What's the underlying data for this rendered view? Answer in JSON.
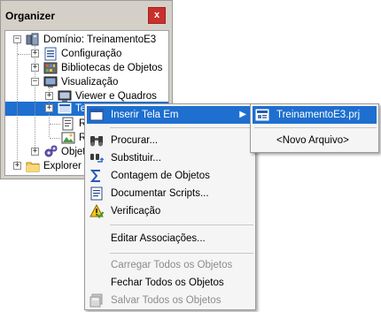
{
  "organizer": {
    "title": "Organizer",
    "close_glyph": "x",
    "tree": [
      {
        "label": "Domínio: TreinamentoE3",
        "icon": "domain-icon"
      },
      {
        "label": "Configuração",
        "icon": "config-icon"
      },
      {
        "label": "Bibliotecas de Objetos",
        "icon": "library-icon"
      },
      {
        "label": "Visualização",
        "icon": "visualization-icon"
      },
      {
        "label": "Viewer e Quadros",
        "icon": "viewer-icon"
      },
      {
        "label": "Te",
        "icon": "screen-icon"
      },
      {
        "label": "Re",
        "icon": "report-icon"
      },
      {
        "label": "Re",
        "icon": "report-image-icon"
      },
      {
        "label": "Objeto",
        "icon": "objects-icon"
      },
      {
        "label": "Explorer",
        "icon": "folder-icon"
      }
    ]
  },
  "context_menu": {
    "items": [
      {
        "label": "Inserir Tela Em",
        "icon": "window-icon",
        "enabled": true,
        "highlighted": true,
        "submenu": true
      },
      {
        "label": "Procurar...",
        "icon": "binoculars-icon",
        "enabled": true
      },
      {
        "label": "Substituir...",
        "icon": "replace-icon",
        "enabled": true
      },
      {
        "label": "Contagem de Objetos",
        "icon": "sigma-icon",
        "enabled": true
      },
      {
        "label": "Documentar Scripts...",
        "icon": "document-icon",
        "enabled": true
      },
      {
        "label": "Verificação",
        "icon": "warning-check-icon",
        "enabled": true
      },
      {
        "label": "Editar Associações...",
        "icon": "",
        "enabled": true
      },
      {
        "label": "Carregar Todos os Objetos",
        "icon": "",
        "enabled": false
      },
      {
        "label": "Fechar Todos os Objetos",
        "icon": "",
        "enabled": true
      },
      {
        "label": "Salvar Todos os Objetos",
        "icon": "save-all-icon",
        "enabled": false
      }
    ]
  },
  "submenu": {
    "items": [
      {
        "label": "TreinamentoE3.prj",
        "icon": "project-icon",
        "highlighted": true
      },
      {
        "label": "<Novo Arquivo>",
        "icon": ""
      }
    ]
  },
  "colors": {
    "highlight": "#1e6fcf",
    "close_button": "#c9302c",
    "panel": "#d4d0c8"
  }
}
